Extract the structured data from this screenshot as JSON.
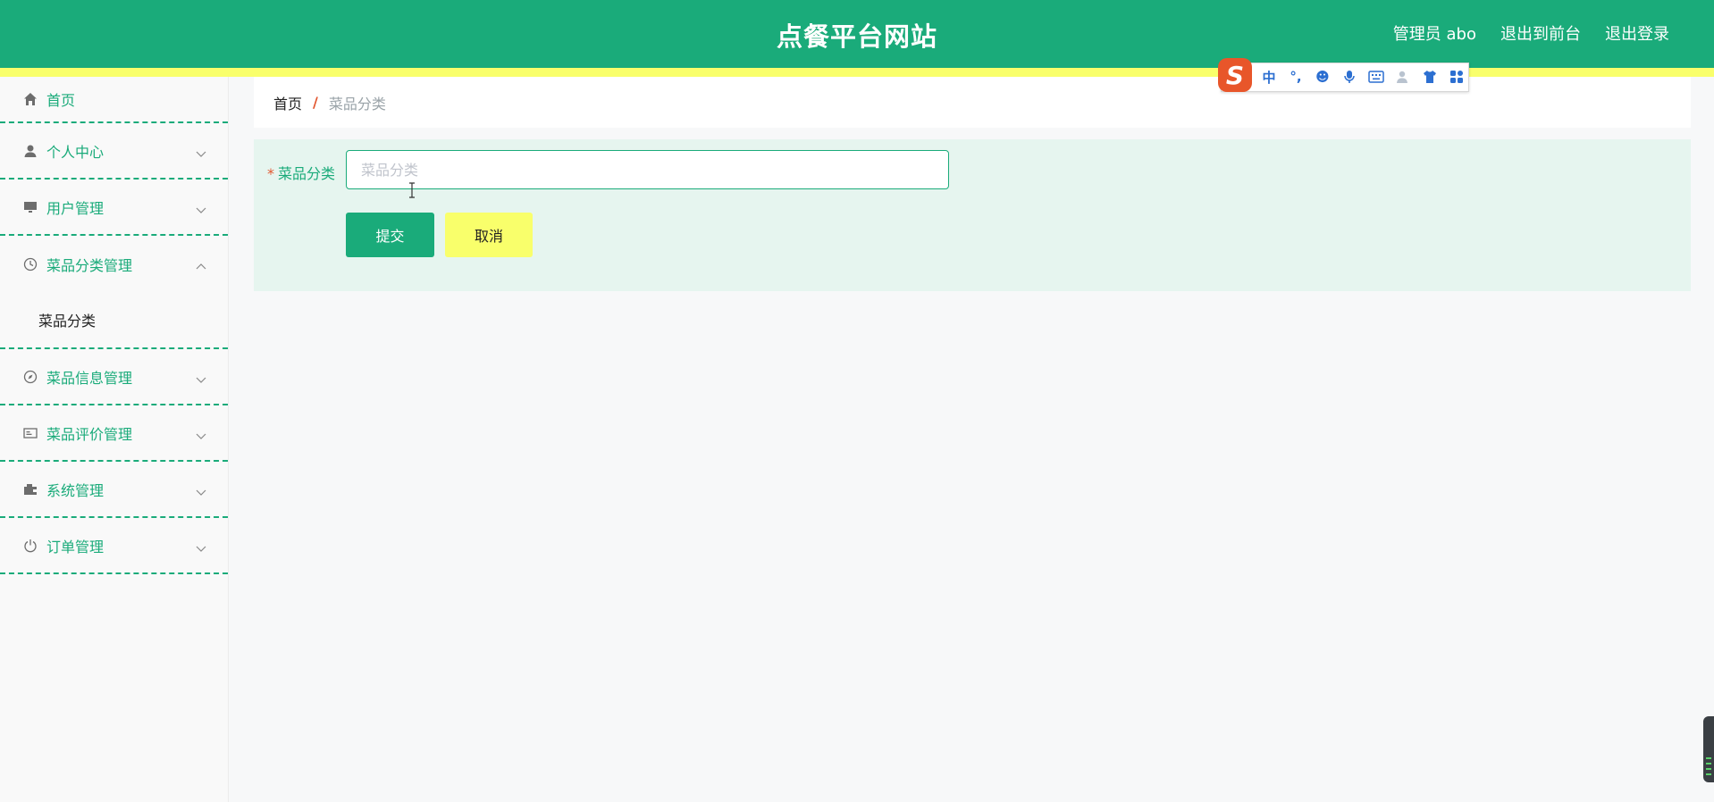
{
  "header": {
    "title": "点餐平台网站",
    "user_label": "管理员 abo",
    "to_front_label": "退出到前台",
    "logout_label": "退出登录",
    "bg_color": "#1aab7a",
    "stripe_color": "#f9ff6b"
  },
  "ime_toolbar": {
    "logo": "S",
    "items": [
      {
        "icon": "chinese-mode-icon",
        "glyph": "中"
      },
      {
        "icon": "punctuation-icon",
        "glyph": "°,"
      },
      {
        "icon": "emoji-icon",
        "glyph": "☻"
      },
      {
        "icon": "microphone-icon",
        "glyph": "🎤"
      },
      {
        "icon": "keyboard-icon",
        "glyph": "⌨"
      },
      {
        "icon": "user-icon",
        "glyph": "👤"
      },
      {
        "icon": "skin-shirt-icon",
        "glyph": "👕"
      },
      {
        "icon": "apps-grid-icon",
        "glyph": "▦"
      }
    ]
  },
  "sidebar": {
    "items": [
      {
        "label": "首页",
        "icon": "home-icon"
      },
      {
        "label": "个人中心",
        "icon": "person-icon"
      },
      {
        "label": "用户管理",
        "icon": "monitor-icon"
      },
      {
        "label": "菜品分类管理",
        "icon": "clock-icon",
        "open": true,
        "children": [
          {
            "label": "菜品分类"
          }
        ]
      },
      {
        "label": "菜品信息管理",
        "icon": "compass-icon"
      },
      {
        "label": "菜品评价管理",
        "icon": "card-icon"
      },
      {
        "label": "系统管理",
        "icon": "wallet-icon"
      },
      {
        "label": "订单管理",
        "icon": "power-icon"
      }
    ]
  },
  "breadcrumb": {
    "home": "首页",
    "separator": "/",
    "current": "菜品分类"
  },
  "form": {
    "required_mark": "*",
    "field_label": "菜品分类",
    "field_value": "",
    "field_placeholder": "菜品分类",
    "submit_label": "提交",
    "cancel_label": "取消"
  }
}
